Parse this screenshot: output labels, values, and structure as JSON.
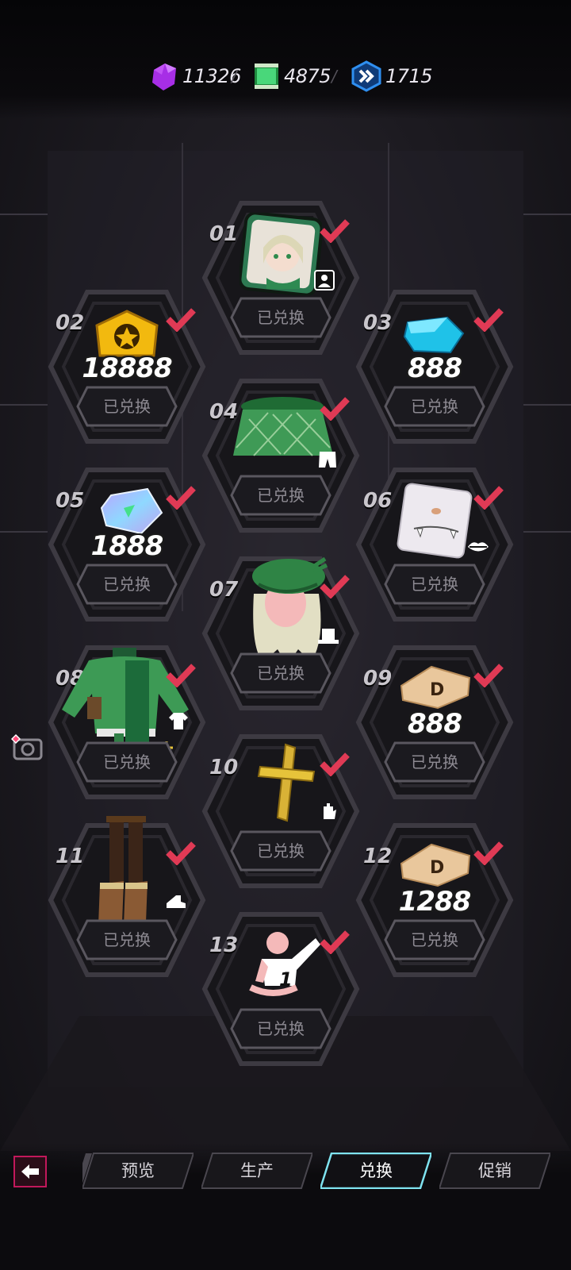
{
  "currencies": [
    {
      "icon": "purple-gem-icon",
      "value": "11326",
      "color": "#b63cf2"
    },
    {
      "icon": "green-ticket-icon",
      "value": "4875",
      "color": "#3ccf6a"
    },
    {
      "icon": "blue-chevron-token-icon",
      "value": "1715",
      "color": "#2f8ff0"
    }
  ],
  "separator": "/",
  "slots": [
    {
      "index": "01",
      "status": "已兑换",
      "item": "avatar-frame",
      "type_icon": "portrait-icon"
    },
    {
      "index": "02",
      "status": "已兑换",
      "item": "gold-star-badge",
      "quantity": "18888"
    },
    {
      "index": "03",
      "status": "已兑换",
      "item": "blue-crystal",
      "quantity": "888"
    },
    {
      "index": "04",
      "status": "已兑换",
      "item": "green-plaid-skirt",
      "type_icon": "shorts-icon"
    },
    {
      "index": "05",
      "status": "已兑换",
      "item": "holo-crystal",
      "quantity": "1888"
    },
    {
      "index": "06",
      "status": "已兑换",
      "item": "face-expression-card",
      "type_icon": "lips-icon"
    },
    {
      "index": "07",
      "status": "已兑换",
      "item": "green-beret-hair",
      "type_icon": "hat-icon"
    },
    {
      "index": "08",
      "status": "已兑换",
      "item": "green-jacket-outfit",
      "type_icon": "shirt-icon"
    },
    {
      "index": "09",
      "status": "已兑换",
      "item": "d-ticket",
      "quantity": "888"
    },
    {
      "index": "10",
      "status": "已兑换",
      "item": "gold-cross",
      "type_icon": "glove-icon"
    },
    {
      "index": "11",
      "status": "已兑换",
      "item": "brown-boots",
      "type_icon": "shoe-icon"
    },
    {
      "index": "12",
      "status": "已兑换",
      "item": "d-ticket",
      "quantity": "1288"
    },
    {
      "index": "13",
      "status": "已兑换",
      "item": "pose-emote",
      "type_icon": "pose-icon",
      "badge": "1"
    }
  ],
  "nav": {
    "tabs": [
      {
        "label": "预览",
        "active": false
      },
      {
        "label": "生产",
        "active": false
      },
      {
        "label": "兑换",
        "active": true
      },
      {
        "label": "促销",
        "active": false
      }
    ],
    "back_icon": "arrow-left-icon"
  },
  "colors": {
    "accent": "#e03a55",
    "active_tab": "#7fe3f0",
    "back_border": "#c2185b"
  }
}
